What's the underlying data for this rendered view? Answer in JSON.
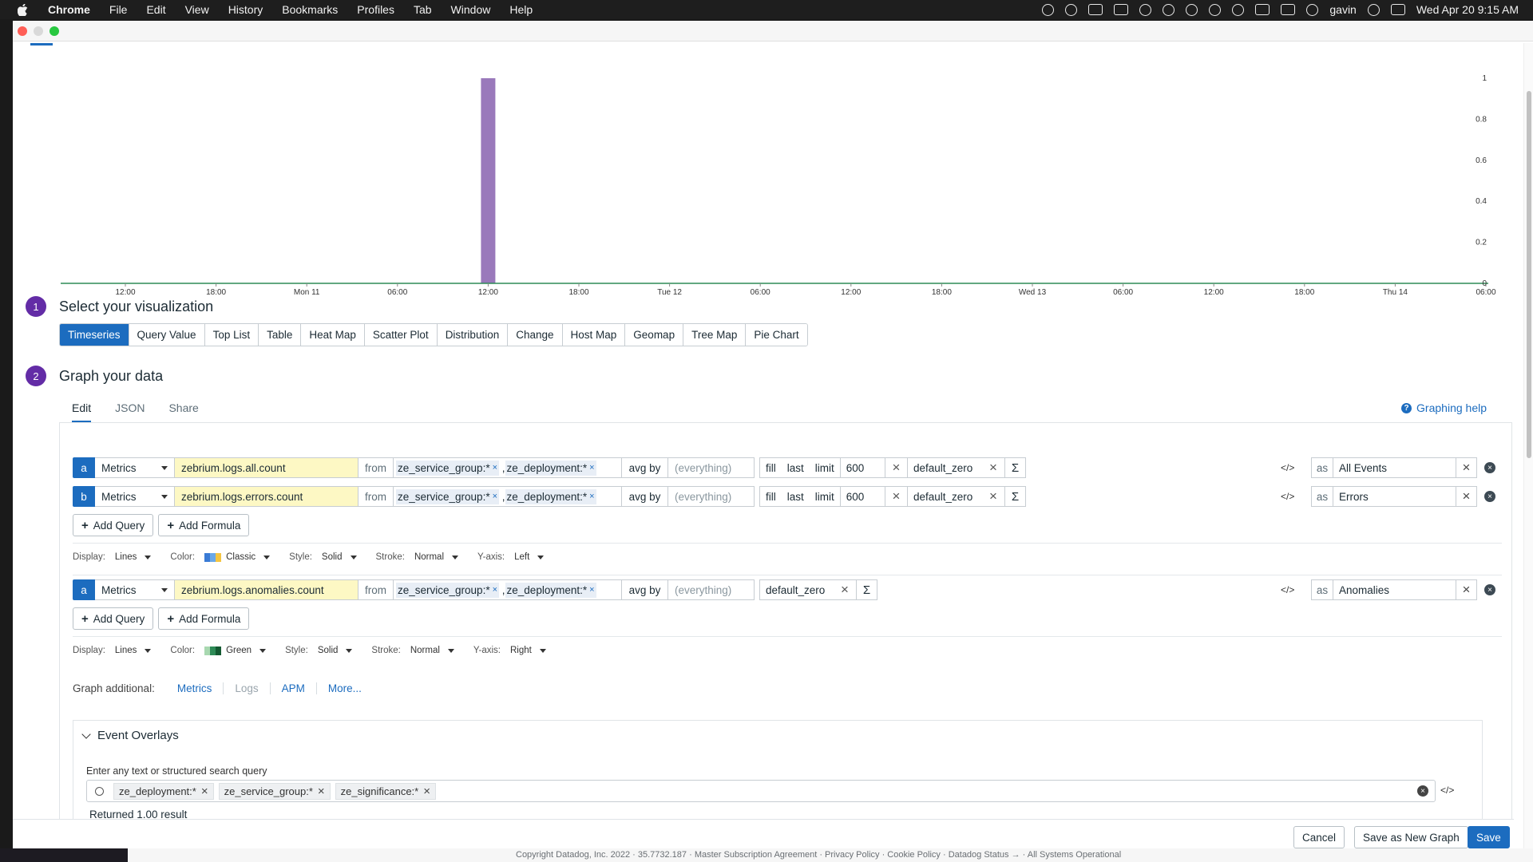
{
  "menubar": {
    "app": "Chrome",
    "items": [
      "File",
      "Edit",
      "View",
      "History",
      "Bookmarks",
      "Profiles",
      "Tab",
      "Window",
      "Help"
    ],
    "user": "gavin",
    "datetime": "Wed Apr 20  9:15 AM"
  },
  "chart_data": {
    "type": "bar",
    "title": "",
    "x_ticks": [
      "12:00",
      "18:00",
      "Mon 11",
      "06:00",
      "12:00",
      "18:00",
      "Tue 12",
      "06:00",
      "12:00",
      "18:00",
      "Wed 13",
      "06:00",
      "12:00",
      "18:00",
      "Thu 14",
      "06:00"
    ],
    "y_ticks": [
      "1",
      "0.8",
      "0.6",
      "0.4",
      "0.2",
      "0"
    ],
    "ylim": [
      0,
      1
    ],
    "series": [
      {
        "values": [
          0,
          0,
          0,
          0,
          1,
          0,
          0,
          0,
          0,
          0,
          0,
          0,
          0,
          0,
          0,
          0
        ],
        "color": "#9a79bb"
      }
    ],
    "baseline_color": "#2e8b57",
    "grid": false
  },
  "step1": {
    "num": "1",
    "title": "Select your visualization"
  },
  "viz_tabs": [
    "Timeseries",
    "Query Value",
    "Top List",
    "Table",
    "Heat Map",
    "Scatter Plot",
    "Distribution",
    "Change",
    "Host Map",
    "Geomap",
    "Tree Map",
    "Pie Chart"
  ],
  "step2": {
    "num": "2",
    "title": "Graph your data"
  },
  "edit_tabs": [
    "Edit",
    "JSON",
    "Share"
  ],
  "graphing_help": "Graphing help",
  "queries": [
    {
      "letter": "a",
      "source": "Metrics",
      "metric": "zebrium.logs.all.count",
      "from": "from",
      "tags": [
        "ze_service_group:*",
        "ze_deployment:*"
      ],
      "avg": "avg by",
      "everything": "(everything)",
      "fill": "fill",
      "last": "last",
      "limit": "limit",
      "limit_value": "600",
      "rollup": "default_zero",
      "as": "as",
      "alias": "All Events"
    },
    {
      "letter": "b",
      "source": "Metrics",
      "metric": "zebrium.logs.errors.count",
      "from": "from",
      "tags": [
        "ze_service_group:*",
        "ze_deployment:*"
      ],
      "avg": "avg by",
      "everything": "(everything)",
      "fill": "fill",
      "last": "last",
      "limit": "limit",
      "limit_value": "600",
      "rollup": "default_zero",
      "as": "as",
      "alias": "Errors"
    },
    {
      "letter": "a",
      "source": "Metrics",
      "metric": "zebrium.logs.anomalies.count",
      "from": "from",
      "tags": [
        "ze_service_group:*",
        "ze_deployment:*"
      ],
      "avg": "avg by",
      "everything": "(everything)",
      "rollup": "default_zero",
      "as": "as",
      "alias": "Anomalies"
    }
  ],
  "buttons": {
    "add_query": "Add Query",
    "add_formula": "Add Formula"
  },
  "display1": {
    "display_label": "Display:",
    "display": "Lines",
    "color_label": "Color:",
    "color": "Classic",
    "style_label": "Style:",
    "style": "Solid",
    "stroke_label": "Stroke:",
    "stroke": "Normal",
    "yaxis_label": "Y-axis:",
    "yaxis": "Left",
    "swatch": [
      "#3a7bd5",
      "#6aa8e8",
      "#f4c542"
    ]
  },
  "display2": {
    "display_label": "Display:",
    "display": "Lines",
    "color_label": "Color:",
    "color": "Green",
    "style_label": "Style:",
    "style": "Solid",
    "stroke_label": "Stroke:",
    "stroke": "Normal",
    "yaxis_label": "Y-axis:",
    "yaxis": "Right",
    "swatch": [
      "#a8d8b0",
      "#2e8b57",
      "#145a32"
    ]
  },
  "graph_additional": {
    "label": "Graph additional:",
    "links": [
      "Metrics",
      "Logs",
      "APM",
      "More..."
    ]
  },
  "overlays": {
    "title": "Event Overlays",
    "hint": "Enter any text or structured search query",
    "chips": [
      "ze_deployment:*",
      "ze_service_group:*",
      "ze_significance:*"
    ],
    "result": "Returned 1.00 result"
  },
  "footer": {
    "cancel": "Cancel",
    "save_new": "Save as New Graph",
    "save": "Save"
  },
  "bg_footer": "Copyright Datadog, Inc. 2022 · 35.7732.187 · Master Subscription Agreement · Privacy Policy · Cookie Policy · Datadog Status → · All Systems Operational"
}
